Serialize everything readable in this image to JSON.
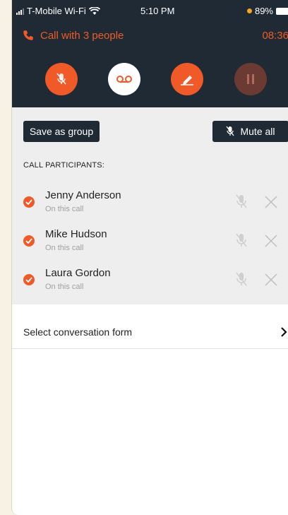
{
  "status_bar": {
    "carrier": "T-Mobile Wi-Fi",
    "time": "5:10 PM",
    "battery": "89%",
    "icons": [
      "signal-icon",
      "wifi-icon",
      "low-power-dot-icon",
      "battery-icon"
    ]
  },
  "call": {
    "title": "Call with 3 people",
    "timer": "08:36",
    "icon": "phone-icon"
  },
  "controls": [
    {
      "name": "mute-mic-button",
      "icon": "mic-off-icon"
    },
    {
      "name": "voicemail-button",
      "icon": "voicemail-icon"
    },
    {
      "name": "edit-button",
      "icon": "pencil-icon"
    },
    {
      "name": "hold-button",
      "icon": "pause-icon"
    }
  ],
  "actions": {
    "save_group": "Save as group",
    "mute_all": "Mute all"
  },
  "section_label": "CALL PARTICIPANTS:",
  "participants": [
    {
      "name": "Jenny Anderson",
      "status": "On this call"
    },
    {
      "name": "Mike Hudson",
      "status": "On this call"
    },
    {
      "name": "Laura Gordon",
      "status": "On this call"
    }
  ],
  "form_row": {
    "label": "Select conversation form"
  },
  "colors": {
    "accent": "#f05a28",
    "header_bg": "#1f2a35",
    "panel_bg": "#eeeeee"
  }
}
